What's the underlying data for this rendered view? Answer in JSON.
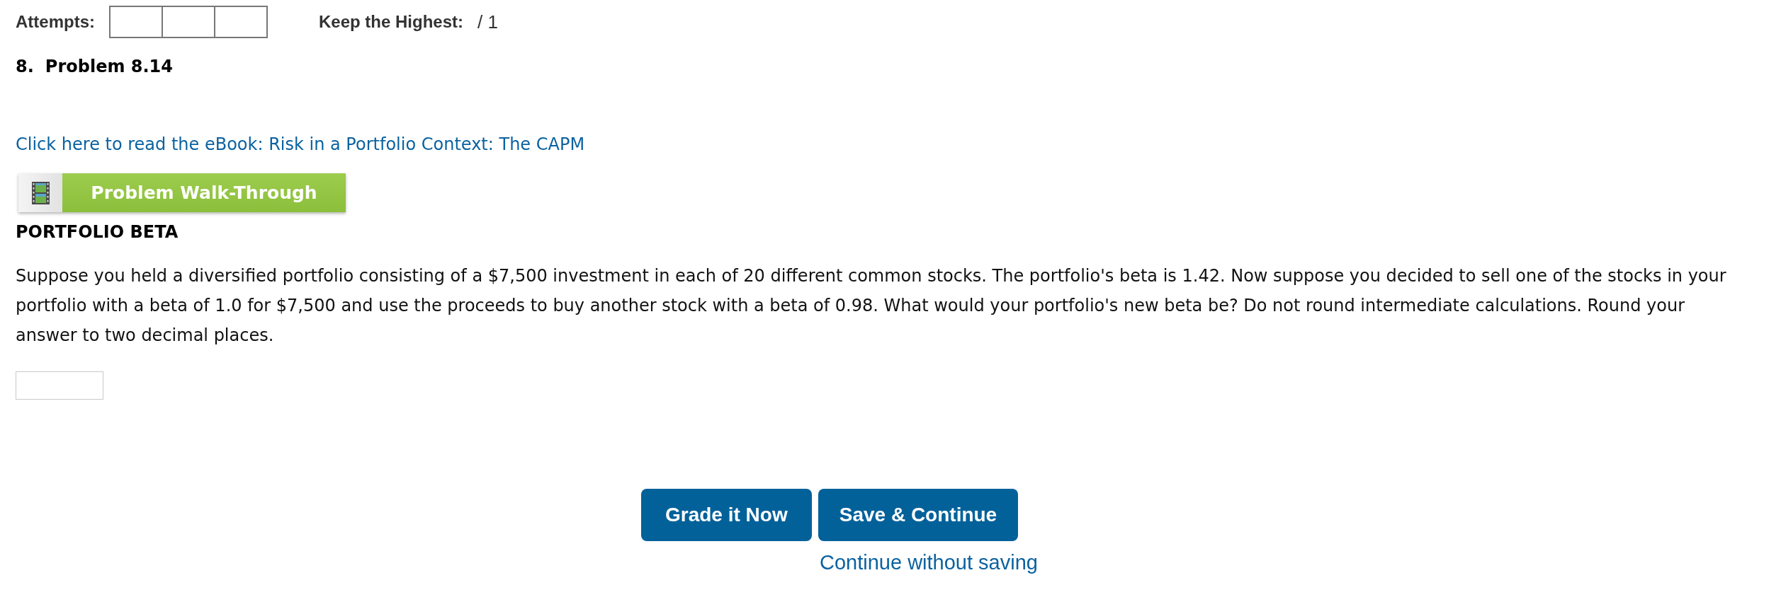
{
  "attempts": {
    "label": "Attempts:",
    "slots": [
      {
        "filled": false
      },
      {
        "filled": false
      },
      {
        "filled": false
      }
    ]
  },
  "keep_highest": {
    "label": "Keep the Highest:",
    "score": "/ 1"
  },
  "problem": {
    "number": "8.",
    "title": "Problem 8.14"
  },
  "ebook_link": "Click here to read the eBook: Risk in a Portfolio Context: The CAPM",
  "walkthrough_button": {
    "label": "Problem Walk-Through"
  },
  "section_heading": "PORTFOLIO BETA",
  "question": "Suppose you held a diversified portfolio consisting of a $7,500 investment in each of 20 different common stocks. The portfolio's beta is 1.42. Now suppose you decided to sell one of the stocks in your portfolio with a beta of 1.0 for $7,500 and use the proceeds to buy another stock with a beta of 0.98. What would your portfolio's new beta be? Do not round intermediate calculations. Round your answer to two decimal places.",
  "buttons": [
    {
      "label": "Grade it Now"
    },
    {
      "label": "Save & Continue"
    }
  ],
  "continue_link": "Continue without saving"
}
